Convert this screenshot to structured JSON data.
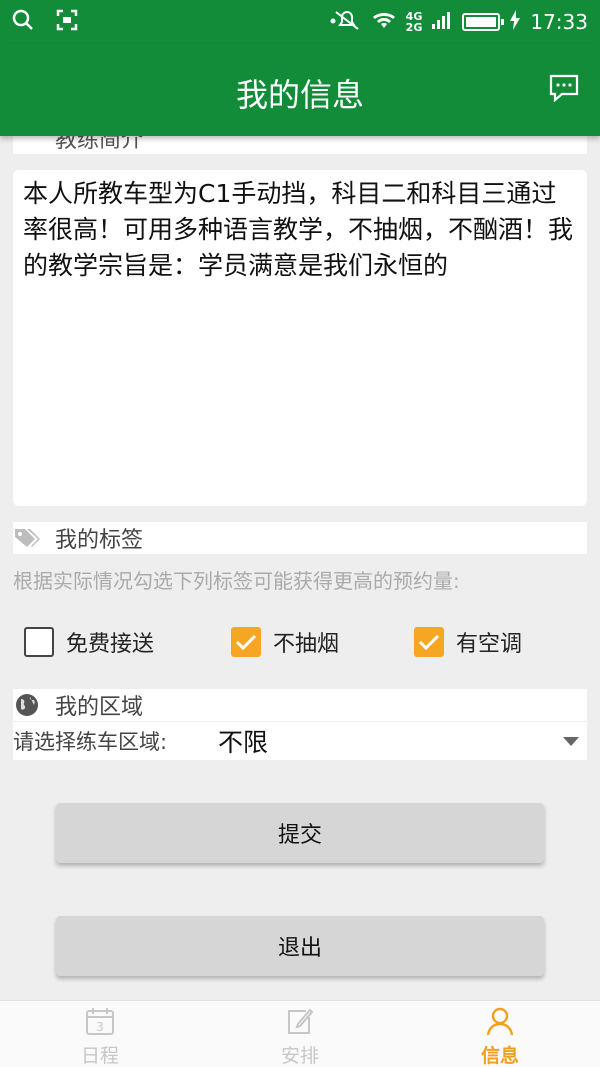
{
  "status_bar": {
    "time": "17:33",
    "network_top": "4G",
    "network_bottom": "2G"
  },
  "app_bar": {
    "title": "我的信息"
  },
  "intro": {
    "cut_label": "教练简介",
    "text": "本人所教车型为C1手动挡，科目二和科目三通过率很高！可用多种语言教学，不抽烟，不酗酒！我的教学宗旨是：学员满意是我们永恒的"
  },
  "tags": {
    "title": "我的标签",
    "hint": "根据实际情况勾选下列标签可能获得更高的预约量:",
    "options": [
      {
        "label": "免费接送",
        "checked": false
      },
      {
        "label": "不抽烟",
        "checked": true
      },
      {
        "label": "有空调",
        "checked": true
      }
    ]
  },
  "region": {
    "title": "我的区域",
    "select_label": "请选择练车区域:",
    "selected": "不限"
  },
  "buttons": {
    "submit": "提交",
    "logout": "退出"
  },
  "bottom_nav": {
    "items": [
      {
        "label": "日程",
        "icon": "calendar-icon",
        "badge": "3",
        "active": false
      },
      {
        "label": "安排",
        "icon": "edit-note-icon",
        "active": false
      },
      {
        "label": "信息",
        "icon": "person-icon",
        "active": true
      }
    ]
  },
  "colors": {
    "primary": "#138c3a",
    "accent": "#f5a623",
    "active_tab": "#f0a020"
  }
}
